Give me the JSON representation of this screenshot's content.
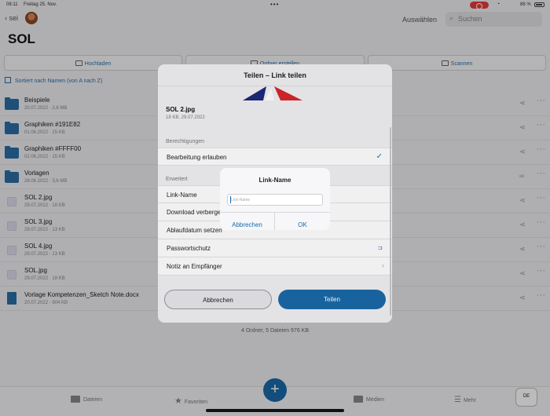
{
  "status": {
    "time": "08:11",
    "date": "Freitag 25. Nov.",
    "battery": "86 %"
  },
  "nav": {
    "back_label": "sei",
    "select_label": "Auswählen",
    "search_placeholder": "Suchen",
    "title": "SOL"
  },
  "toolbar": {
    "upload": "Hochladen",
    "new_folder": "Ordner erstellen",
    "scan": "Scannen"
  },
  "sort_label": "Sortiert nach Namen (von A nach Z)",
  "files": [
    {
      "name": "Beispiele",
      "meta": "20.07.2022 · 2,6 MB",
      "kind": "folder"
    },
    {
      "name": "Graphiken #191E82",
      "meta": "01.06.2022 · 15 KB",
      "kind": "folder"
    },
    {
      "name": "Graphiken #FFFF00",
      "meta": "02.06.2022 · 15 KB",
      "kind": "folder"
    },
    {
      "name": "Vorlagen",
      "meta": "28.06.2022 · 3,6 MB",
      "kind": "shared-folder"
    },
    {
      "name": "SOL 2.jpg",
      "meta": "29.07.2022 · 18 KB",
      "kind": "image"
    },
    {
      "name": "SOL 3.jpg",
      "meta": "29.07.2022 · 13 KB",
      "kind": "image"
    },
    {
      "name": "SOL 4.jpg",
      "meta": "29.07.2022 · 13 KB",
      "kind": "image"
    },
    {
      "name": "SOL.jpg",
      "meta": "29.07.2022 · 18 KB",
      "kind": "image"
    },
    {
      "name": "Vorlage Kompetenzen_Sketch Note.docx",
      "meta": "20.07.2022 · 904 KB",
      "kind": "doc"
    }
  ],
  "footer_count": "4 Ordner, 5 Dateien 976 KB",
  "tabs": {
    "files": "Dateien",
    "favorites": "Favoriten",
    "media": "Medien",
    "more": "Mehr"
  },
  "keyboard_key": "DE",
  "sheet": {
    "title": "Teilen – Link teilen",
    "file_name": "SOL 2.jpg",
    "file_meta": "18 KB, 29.07.2022",
    "permissions_header": "Berechtigungen",
    "allow_edit": "Bearbeitung erlauben",
    "advanced_header": "Erweitert",
    "link_name": "Link-Name",
    "download": "Download verbergen",
    "expiry": "Ablaufdatum setzen",
    "password": "Passwortschutz",
    "note": "Notiz an Empfänger",
    "cancel": "Abbrechen",
    "share": "Teilen"
  },
  "alert": {
    "title": "Link-Name",
    "placeholder": "Link-Name",
    "value": "",
    "cancel": "Abbrechen",
    "ok": "OK"
  }
}
